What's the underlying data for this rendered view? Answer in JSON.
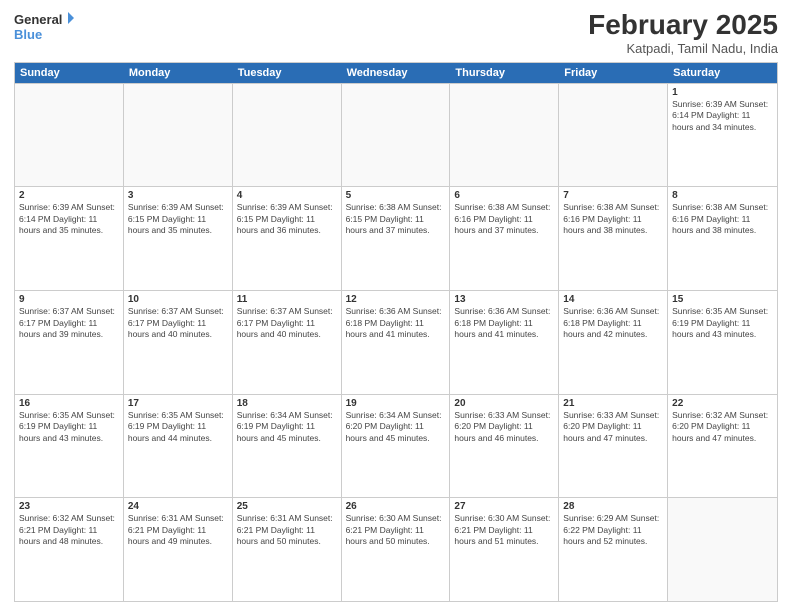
{
  "header": {
    "logo_line1": "General",
    "logo_line2": "Blue",
    "month_year": "February 2025",
    "location": "Katpadi, Tamil Nadu, India"
  },
  "day_headers": [
    "Sunday",
    "Monday",
    "Tuesday",
    "Wednesday",
    "Thursday",
    "Friday",
    "Saturday"
  ],
  "weeks": [
    [
      {
        "day": "",
        "info": ""
      },
      {
        "day": "",
        "info": ""
      },
      {
        "day": "",
        "info": ""
      },
      {
        "day": "",
        "info": ""
      },
      {
        "day": "",
        "info": ""
      },
      {
        "day": "",
        "info": ""
      },
      {
        "day": "1",
        "info": "Sunrise: 6:39 AM\nSunset: 6:14 PM\nDaylight: 11 hours and 34 minutes."
      }
    ],
    [
      {
        "day": "2",
        "info": "Sunrise: 6:39 AM\nSunset: 6:14 PM\nDaylight: 11 hours and 35 minutes."
      },
      {
        "day": "3",
        "info": "Sunrise: 6:39 AM\nSunset: 6:15 PM\nDaylight: 11 hours and 35 minutes."
      },
      {
        "day": "4",
        "info": "Sunrise: 6:39 AM\nSunset: 6:15 PM\nDaylight: 11 hours and 36 minutes."
      },
      {
        "day": "5",
        "info": "Sunrise: 6:38 AM\nSunset: 6:15 PM\nDaylight: 11 hours and 37 minutes."
      },
      {
        "day": "6",
        "info": "Sunrise: 6:38 AM\nSunset: 6:16 PM\nDaylight: 11 hours and 37 minutes."
      },
      {
        "day": "7",
        "info": "Sunrise: 6:38 AM\nSunset: 6:16 PM\nDaylight: 11 hours and 38 minutes."
      },
      {
        "day": "8",
        "info": "Sunrise: 6:38 AM\nSunset: 6:16 PM\nDaylight: 11 hours and 38 minutes."
      }
    ],
    [
      {
        "day": "9",
        "info": "Sunrise: 6:37 AM\nSunset: 6:17 PM\nDaylight: 11 hours and 39 minutes."
      },
      {
        "day": "10",
        "info": "Sunrise: 6:37 AM\nSunset: 6:17 PM\nDaylight: 11 hours and 40 minutes."
      },
      {
        "day": "11",
        "info": "Sunrise: 6:37 AM\nSunset: 6:17 PM\nDaylight: 11 hours and 40 minutes."
      },
      {
        "day": "12",
        "info": "Sunrise: 6:36 AM\nSunset: 6:18 PM\nDaylight: 11 hours and 41 minutes."
      },
      {
        "day": "13",
        "info": "Sunrise: 6:36 AM\nSunset: 6:18 PM\nDaylight: 11 hours and 41 minutes."
      },
      {
        "day": "14",
        "info": "Sunrise: 6:36 AM\nSunset: 6:18 PM\nDaylight: 11 hours and 42 minutes."
      },
      {
        "day": "15",
        "info": "Sunrise: 6:35 AM\nSunset: 6:19 PM\nDaylight: 11 hours and 43 minutes."
      }
    ],
    [
      {
        "day": "16",
        "info": "Sunrise: 6:35 AM\nSunset: 6:19 PM\nDaylight: 11 hours and 43 minutes."
      },
      {
        "day": "17",
        "info": "Sunrise: 6:35 AM\nSunset: 6:19 PM\nDaylight: 11 hours and 44 minutes."
      },
      {
        "day": "18",
        "info": "Sunrise: 6:34 AM\nSunset: 6:19 PM\nDaylight: 11 hours and 45 minutes."
      },
      {
        "day": "19",
        "info": "Sunrise: 6:34 AM\nSunset: 6:20 PM\nDaylight: 11 hours and 45 minutes."
      },
      {
        "day": "20",
        "info": "Sunrise: 6:33 AM\nSunset: 6:20 PM\nDaylight: 11 hours and 46 minutes."
      },
      {
        "day": "21",
        "info": "Sunrise: 6:33 AM\nSunset: 6:20 PM\nDaylight: 11 hours and 47 minutes."
      },
      {
        "day": "22",
        "info": "Sunrise: 6:32 AM\nSunset: 6:20 PM\nDaylight: 11 hours and 47 minutes."
      }
    ],
    [
      {
        "day": "23",
        "info": "Sunrise: 6:32 AM\nSunset: 6:21 PM\nDaylight: 11 hours and 48 minutes."
      },
      {
        "day": "24",
        "info": "Sunrise: 6:31 AM\nSunset: 6:21 PM\nDaylight: 11 hours and 49 minutes."
      },
      {
        "day": "25",
        "info": "Sunrise: 6:31 AM\nSunset: 6:21 PM\nDaylight: 11 hours and 50 minutes."
      },
      {
        "day": "26",
        "info": "Sunrise: 6:30 AM\nSunset: 6:21 PM\nDaylight: 11 hours and 50 minutes."
      },
      {
        "day": "27",
        "info": "Sunrise: 6:30 AM\nSunset: 6:21 PM\nDaylight: 11 hours and 51 minutes."
      },
      {
        "day": "28",
        "info": "Sunrise: 6:29 AM\nSunset: 6:22 PM\nDaylight: 11 hours and 52 minutes."
      },
      {
        "day": "",
        "info": ""
      }
    ]
  ]
}
